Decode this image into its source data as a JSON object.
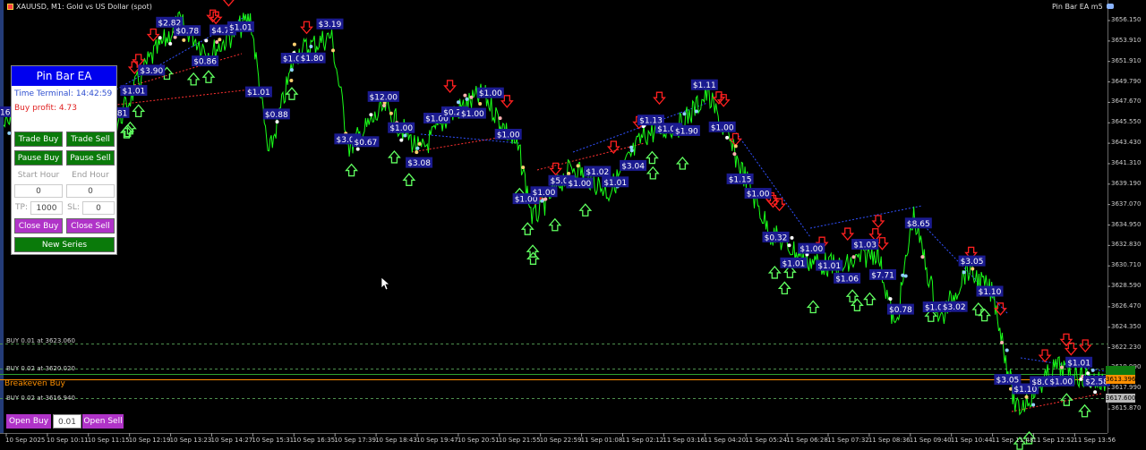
{
  "window": {
    "title": "XAUUSD, M1:  Gold vs US Dollar (spot)",
    "ea_name": "Pin Bar EA m5"
  },
  "price_axis": {
    "labels": [
      "3656.150",
      "3653.910",
      "3651.910",
      "3649.790",
      "3647.670",
      "3645.550",
      "3643.430",
      "3641.310",
      "3639.190",
      "3637.070",
      "3634.950",
      "3632.830",
      "3630.710",
      "3628.590",
      "3626.470",
      "3624.350",
      "3622.230",
      "3619.990",
      "3617.990",
      "3615.870"
    ],
    "current_sell": "3613.396",
    "current_buy": "3617.600",
    "green_tag": ""
  },
  "time_axis": {
    "labels": [
      "10 Sep 2025",
      "10 Sep 10:11",
      "10 Sep 11:15",
      "10 Sep 12:19",
      "10 Sep 13:23",
      "10 Sep 14:27",
      "10 Sep 15:31",
      "10 Sep 16:35",
      "10 Sep 17:39",
      "10 Sep 18:43",
      "10 Sep 19:47",
      "10 Sep 20:51",
      "10 Sep 21:55",
      "10 Sep 22:59",
      "11 Sep 01:08",
      "11 Sep 02:12",
      "11 Sep 03:16",
      "11 Sep 04:20",
      "11 Sep 05:24",
      "11 Sep 06:28",
      "11 Sep 07:32",
      "11 Sep 08:36",
      "11 Sep 09:40",
      "11 Sep 10:44",
      "11 Sep 11:48",
      "11 Sep 12:52",
      "11 Sep 13:56"
    ]
  },
  "horizontal_lines": {
    "buy1": "BUY 0.01 at 3623.060",
    "buy2": "BUY 0.02 at 3620.020",
    "breakeven": "Breakeven Buy",
    "buy3": "BUY 0.02 at 3616.940"
  },
  "profit_labels": [
    "$16.98",
    "$3.04",
    "$2.89",
    "$1.61",
    "$0.98",
    "$1.61",
    "$0.81",
    "$1.01",
    "$3.90",
    "$2.82",
    "$0.78",
    "$0.86",
    "$4.79",
    "$1.01",
    "$1.01",
    "$0.88",
    "$1.08",
    "$1.80",
    "$3.19",
    "$3.03",
    "$0.67",
    "$12.00",
    "$1.00",
    "$3.08",
    "$1.00",
    "$0.26",
    "$1.00",
    "$1.00",
    "$1.00",
    "$1.00",
    "$1.00",
    "$5.01",
    "$1.00",
    "$1.02",
    "$1.01",
    "$3.04",
    "$1.13",
    "$1.02",
    "$1.90",
    "$1.11",
    "$1.00",
    "$1.15",
    "$1.00",
    "$0.32",
    "$1.01",
    "$1.00",
    "$1.01",
    "$1.06",
    "$1.03",
    "$7.71",
    "$0.78",
    "$8.65",
    "$1.01",
    "$3.02",
    "$3.05",
    "$1.10",
    "$3.05",
    "$1.10",
    "$8.04",
    "$1.00",
    "$1.01",
    "$2.58"
  ],
  "panel": {
    "title": "Pin Bar EA",
    "time_terminal": "Time Terminal: 14:42:59",
    "buy_profit": "Buy profit: 4.73",
    "trade_buy": "Trade Buy",
    "trade_sell": "Trade Sell",
    "pause_buy": "Pause Buy",
    "pause_sell": "Pause Sell",
    "start_hour_label": "Start Hour",
    "end_hour_label": "End Hour",
    "start_hour": "0",
    "end_hour": "0",
    "tp_label": "TP:",
    "tp": "1000",
    "sl_label": "SL:",
    "sl": "0",
    "close_buy": "Close Buy",
    "close_sell": "Close Sell",
    "new_series": "New Series"
  },
  "bottom": {
    "open_buy": "Open Buy",
    "lot": "0.01",
    "open_sell": "Open Sell"
  },
  "colors": {
    "price_line": "#19ff19",
    "buy_line": "#ff8c00",
    "grid": "#1f5f1f",
    "profit_box": "#1b1b90",
    "panel_header": "#0000ee"
  }
}
